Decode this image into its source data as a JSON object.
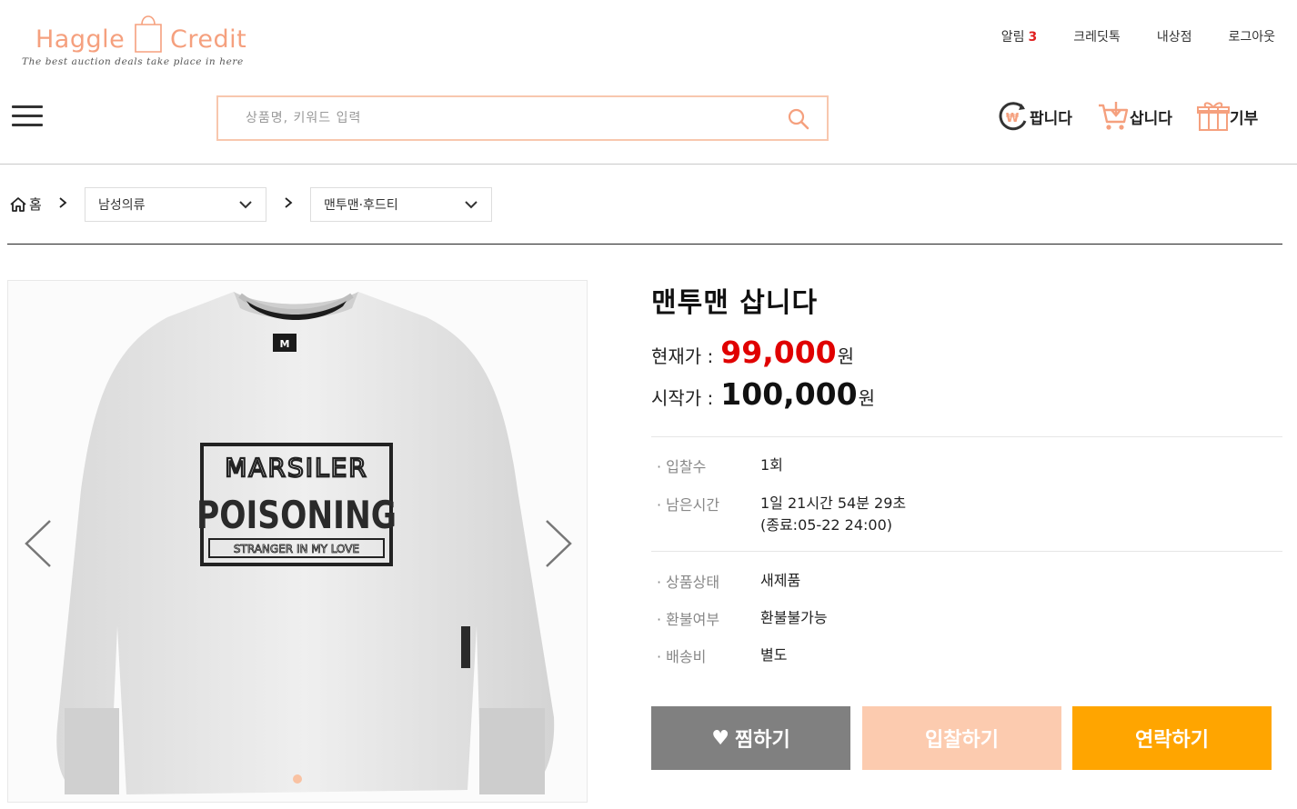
{
  "header": {
    "logo_word_1": "Haggle",
    "logo_word_2": "Credit",
    "logo_tagline": "The best auction deals take place in here",
    "top_links": {
      "alerts_label": "알림",
      "alerts_count": "3",
      "credit_talk": "크레딧톡",
      "my_shop": "내상점",
      "logout": "로그아웃"
    },
    "search": {
      "placeholder": "상품명, 키워드 입력",
      "value": ""
    },
    "quick_links": {
      "sell": "팝니다",
      "buy": "삽니다",
      "donate": "기부"
    }
  },
  "breadcrumb": {
    "home": "홈",
    "category": "남성의류",
    "subcategory": "맨투맨·후드티"
  },
  "product": {
    "title": "맨투맨 삽니다",
    "current_price_label": "현재가 :",
    "current_price": "99,000",
    "start_price_label": "시작가 :",
    "start_price": "100,000",
    "currency": "원",
    "details": {
      "bids_label": "· 입찰수",
      "bids_value": "1회",
      "remaining_label": "· 남은시간",
      "remaining_value": "1일 21시간 54분 29초",
      "end_value": "(종료:05-22 24:00)",
      "condition_label": "· 상품상태",
      "condition_value": "새제품",
      "refund_label": "· 환불여부",
      "refund_value": "환불불가능",
      "shipping_label": "· 배송비",
      "shipping_value": "별도"
    },
    "image_text": {
      "line1": "MARSILER",
      "line2": "POISONING",
      "line3": "STRANGER IN MY LOVE",
      "neck_tag": "M"
    },
    "slide_index": 1
  },
  "buttons": {
    "wish": "찜하기",
    "bid": "입찰하기",
    "contact": "연락하기"
  },
  "colors": {
    "brand": "#f5a07e",
    "search_border": "#f8c7ae",
    "price_red": "#e00000",
    "wish_bg": "#808080",
    "bid_bg": "#fccbaf",
    "contact_bg": "#ffa500"
  }
}
